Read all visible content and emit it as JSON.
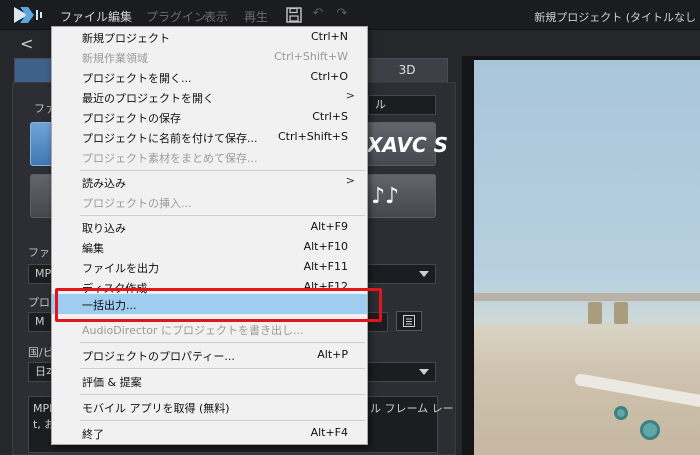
{
  "menubar": {
    "file": "ファイル",
    "edit": "編集",
    "plugins": "プラグイン",
    "view": "表示",
    "playback": "再生",
    "window_title": "新規プロジェクト (タイトルなし"
  },
  "icons": {
    "save": "floppy-disk",
    "undo": "undo-arrow",
    "redo": "redo-arrow",
    "back": "back-arrow",
    "list": "list"
  },
  "left_panel": {
    "tab_3d": "3D",
    "label_file": "ファ",
    "label_right": "ル",
    "avc_button_text": "XAVC S",
    "audio_button_text": "♪♪",
    "label_file_format": "ファイ",
    "select_mpeg": "MP",
    "label_profile": "プロ",
    "select_profile": "M",
    "label_country": "国/ビ",
    "select_country": "日本",
    "description_left": "MPEG",
    "description_left2": "t, お",
    "description_right": "ル フレーム レー"
  },
  "file_menu": {
    "items": [
      {
        "label": "新規プロジェクト",
        "shortcut": "Ctrl+N",
        "disabled": false
      },
      {
        "label": "新規作業領域",
        "shortcut": "Ctrl+Shift+W",
        "disabled": true
      },
      {
        "label": "プロジェクトを開く...",
        "shortcut": "Ctrl+O",
        "disabled": false
      },
      {
        "label": "最近のプロジェクトを開く",
        "submenu": ">",
        "disabled": false
      },
      {
        "label": "プロジェクトの保存",
        "shortcut": "Ctrl+S",
        "disabled": false
      },
      {
        "label": "プロジェクトに名前を付けて保存...",
        "shortcut": "Ctrl+Shift+S",
        "disabled": false
      },
      {
        "label": "プロジェクト素材をまとめて保存...",
        "disabled": true
      },
      {
        "label": "読み込み",
        "submenu": ">",
        "disabled": false
      },
      {
        "label": "プロジェクトの挿入...",
        "disabled": true
      },
      {
        "label": "取り込み",
        "shortcut": "Alt+F9",
        "disabled": false
      },
      {
        "label": "編集",
        "shortcut": "Alt+F10",
        "disabled": false
      },
      {
        "label": "ファイルを出力",
        "shortcut": "Alt+F11",
        "disabled": false
      },
      {
        "label": "ディスク作成",
        "shortcut": "Alt+F12",
        "disabled": false
      },
      {
        "label": "一括出力...",
        "disabled": false,
        "highlighted": true
      },
      {
        "label": "AudioDirector にプロジェクトを書き出し...",
        "disabled": true
      },
      {
        "label": "プロジェクトのプロパティー...",
        "shortcut": "Alt+P",
        "disabled": false
      },
      {
        "label": "評価 & 提案",
        "disabled": false
      },
      {
        "label": "モバイル アプリを取得 (無料)",
        "disabled": false
      },
      {
        "label": "終了",
        "shortcut": "Alt+F4",
        "disabled": false
      }
    ]
  },
  "colors": {
    "accent_highlight": "#9ecdf0",
    "callout_red": "#e0161b"
  }
}
